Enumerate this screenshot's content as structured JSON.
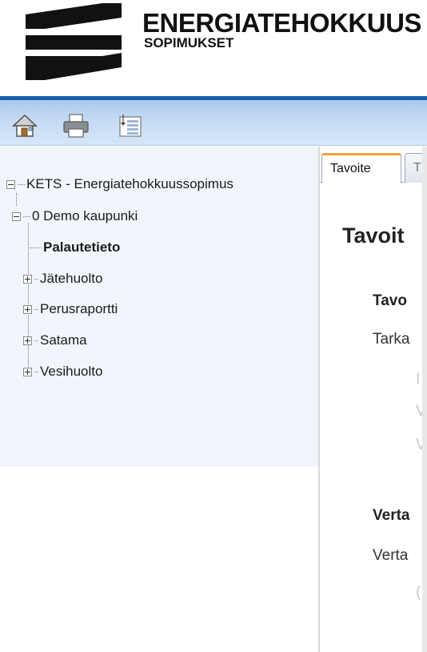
{
  "brand": {
    "title": "ENERGIATEHOKKUUS",
    "subtitle": "SOPIMUKSET",
    "colors": {
      "toolbar_top": "#1b5fae",
      "toolbar_bg": "#c5dbf4",
      "tree_bg": "#f1f6fc",
      "tab_accent": "#f2a33a"
    }
  },
  "toolbar": {
    "icons": [
      "home-icon",
      "print-icon",
      "layout-icon"
    ]
  },
  "tree": {
    "root": {
      "label": "KETS - Energiatehokkuussopimus"
    },
    "org": {
      "label": "0 Demo kaupunki"
    },
    "items": [
      {
        "label": "Palautetieto",
        "bold": true
      },
      {
        "label": "Jätehuolto"
      },
      {
        "label": "Perusraportti"
      },
      {
        "label": "Satama"
      },
      {
        "label": "Vesihuolto"
      }
    ]
  },
  "tabs": [
    {
      "label": "Tavoite",
      "active": true
    },
    {
      "label": "T",
      "active": false
    }
  ],
  "content": {
    "title": "Tavoit",
    "section1_head": "Tavo",
    "section1_text": "Tarka",
    "faint_rows": [
      "I",
      "V",
      "V"
    ],
    "section2_head": "Verta",
    "section2_text": "Verta",
    "faint_last": "("
  }
}
